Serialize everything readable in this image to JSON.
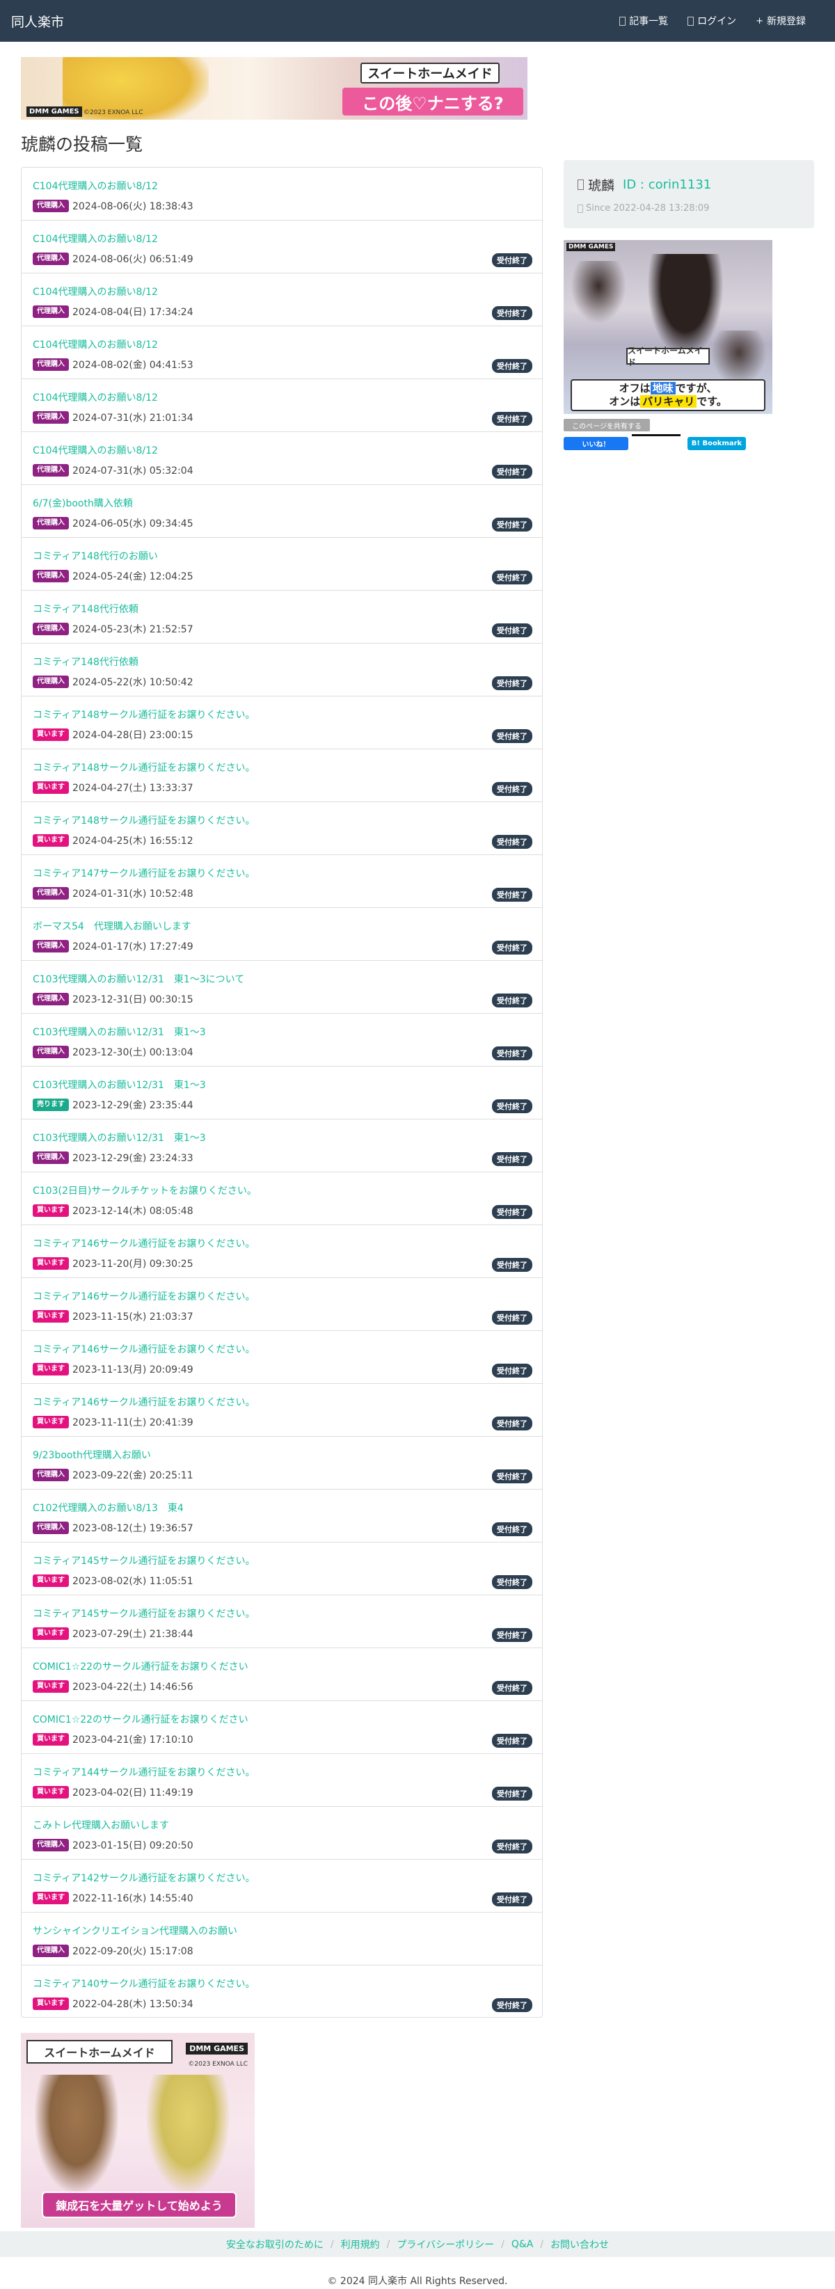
{
  "navbar": {
    "brand": "同人楽市",
    "links": [
      {
        "label": "記事一覧"
      },
      {
        "label": "ログイン"
      },
      {
        "label": "新規登録"
      }
    ]
  },
  "ads": {
    "top": {
      "logo": "スイートホームメイド",
      "tagline": "この後♡ナニする?",
      "brand": "DMM GAMES",
      "copyright": "©2023 EXNOA LLC"
    },
    "side": {
      "brand": "DMM GAMES",
      "logo": "スイートホームメイド",
      "line1_a": "オフは",
      "line1_hl": "地味",
      "line1_b": "ですが、",
      "line2_a": "オンは",
      "line2_hl": "バリキャリ",
      "line2_b": "です。"
    },
    "bottom": {
      "logo": "スイートホームメイド",
      "brand": "DMM GAMES",
      "copyright": "©2023 EXNOA LLC",
      "tagline": "錬成石を大量ゲットして始めよう"
    }
  },
  "page_title": "琥麟の投稿一覧",
  "posts": [
    {
      "title": "C104代理購入のお願い8/12",
      "type": "代理購入",
      "date": "2024-08-06(火) 18:38:43",
      "status": ""
    },
    {
      "title": "C104代理購入のお願い8/12",
      "type": "代理購入",
      "date": "2024-08-06(火) 06:51:49",
      "status": "受付終了"
    },
    {
      "title": "C104代理購入のお願い8/12",
      "type": "代理購入",
      "date": "2024-08-04(日) 17:34:24",
      "status": "受付終了"
    },
    {
      "title": "C104代理購入のお願い8/12",
      "type": "代理購入",
      "date": "2024-08-02(金) 04:41:53",
      "status": "受付終了"
    },
    {
      "title": "C104代理購入のお願い8/12",
      "type": "代理購入",
      "date": "2024-07-31(水) 21:01:34",
      "status": "受付終了"
    },
    {
      "title": "C104代理購入のお願い8/12",
      "type": "代理購入",
      "date": "2024-07-31(水) 05:32:04",
      "status": "受付終了"
    },
    {
      "title": "6/7(金)booth購入依頼",
      "type": "代理購入",
      "date": "2024-06-05(水) 09:34:45",
      "status": "受付終了"
    },
    {
      "title": "コミティア148代行のお願い",
      "type": "代理購入",
      "date": "2024-05-24(金) 12:04:25",
      "status": "受付終了"
    },
    {
      "title": "コミティア148代行依頼",
      "type": "代理購入",
      "date": "2024-05-23(木) 21:52:57",
      "status": "受付終了"
    },
    {
      "title": "コミティア148代行依頼",
      "type": "代理購入",
      "date": "2024-05-22(水) 10:50:42",
      "status": "受付終了"
    },
    {
      "title": "コミティア148サークル通行証をお譲りください。",
      "type": "買います",
      "date": "2024-04-28(日) 23:00:15",
      "status": "受付終了"
    },
    {
      "title": "コミティア148サークル通行証をお譲りください。",
      "type": "買います",
      "date": "2024-04-27(土) 13:33:37",
      "status": "受付終了"
    },
    {
      "title": "コミティア148サークル通行証をお譲りください。",
      "type": "買います",
      "date": "2024-04-25(木) 16:55:12",
      "status": "受付終了"
    },
    {
      "title": "コミティア147サークル通行証をお譲りください。",
      "type": "代理購入",
      "date": "2024-01-31(水) 10:52:48",
      "status": "受付終了"
    },
    {
      "title": "ボーマス54　代理購入お願いします",
      "type": "代理購入",
      "date": "2024-01-17(水) 17:27:49",
      "status": "受付終了"
    },
    {
      "title": "C103代理購入のお願い12/31　東1〜3について",
      "type": "代理購入",
      "date": "2023-12-31(日) 00:30:15",
      "status": "受付終了"
    },
    {
      "title": "C103代理購入のお願い12/31　東1〜3",
      "type": "代理購入",
      "date": "2023-12-30(土) 00:13:04",
      "status": "受付終了"
    },
    {
      "title": "C103代理購入のお願い12/31　東1〜3",
      "type": "売ります",
      "date": "2023-12-29(金) 23:35:44",
      "status": "受付終了"
    },
    {
      "title": "C103代理購入のお願い12/31　東1〜3",
      "type": "代理購入",
      "date": "2023-12-29(金) 23:24:33",
      "status": "受付終了"
    },
    {
      "title": "C103(2日目)サークルチケットをお譲りください。",
      "type": "買います",
      "date": "2023-12-14(木) 08:05:48",
      "status": "受付終了"
    },
    {
      "title": "コミティア146サークル通行証をお譲りください。",
      "type": "買います",
      "date": "2023-11-20(月) 09:30:25",
      "status": "受付終了"
    },
    {
      "title": "コミティア146サークル通行証をお譲りください。",
      "type": "買います",
      "date": "2023-11-15(水) 21:03:37",
      "status": "受付終了"
    },
    {
      "title": "コミティア146サークル通行証をお譲りください。",
      "type": "買います",
      "date": "2023-11-13(月) 20:09:49",
      "status": "受付終了"
    },
    {
      "title": "コミティア146サークル通行証をお譲りください。",
      "type": "買います",
      "date": "2023-11-11(土) 20:41:39",
      "status": "受付終了"
    },
    {
      "title": "9/23booth代理購入お願い",
      "type": "代理購入",
      "date": "2023-09-22(金) 20:25:11",
      "status": "受付終了"
    },
    {
      "title": "C102代理購入のお願い8/13　東4",
      "type": "代理購入",
      "date": "2023-08-12(土) 19:36:57",
      "status": "受付終了"
    },
    {
      "title": "コミティア145サークル通行証をお譲りください。",
      "type": "買います",
      "date": "2023-08-02(水) 11:05:51",
      "status": "受付終了"
    },
    {
      "title": "コミティア145サークル通行証をお譲りください。",
      "type": "買います",
      "date": "2023-07-29(土) 21:38:44",
      "status": "受付終了"
    },
    {
      "title": "COMIC1☆22のサークル通行証をお譲りください",
      "type": "買います",
      "date": "2023-04-22(土) 14:46:56",
      "status": "受付終了"
    },
    {
      "title": "COMIC1☆22のサークル通行証をお譲りください",
      "type": "買います",
      "date": "2023-04-21(金) 17:10:10",
      "status": "受付終了"
    },
    {
      "title": "コミティア144サークル通行証をお譲りください。",
      "type": "買います",
      "date": "2023-04-02(日) 11:49:19",
      "status": "受付終了"
    },
    {
      "title": "こみトレ代理購入お願いします",
      "type": "代理購入",
      "date": "2023-01-15(日) 09:20:50",
      "status": "受付終了"
    },
    {
      "title": "コミティア142サークル通行証をお譲りください。",
      "type": "買います",
      "date": "2022-11-16(水) 14:55:40",
      "status": "受付終了"
    },
    {
      "title": "サンシャインクリエイション代理購入のお願い",
      "type": "代理購入",
      "date": "2022-09-20(火) 15:17:08",
      "status": ""
    },
    {
      "title": "コミティア140サークル通行証をお譲りください。",
      "type": "買います",
      "date": "2022-04-28(木) 13:50:34",
      "status": "受付終了"
    }
  ],
  "profile": {
    "name": "琥麟",
    "id_label": "ID : corin1131",
    "since": "Since 2022-04-28 13:28:09"
  },
  "share": {
    "share_label": "このページを共有する",
    "like_label": "いいね！",
    "bookmark_label": "B! Bookmark"
  },
  "footer": {
    "links": [
      "安全なお取引のために",
      "利用規約",
      "プライバシーポリシー",
      "Q&A",
      "お問い合わせ"
    ],
    "copyright": "© 2024 同人楽市 All Rights Reserved."
  }
}
